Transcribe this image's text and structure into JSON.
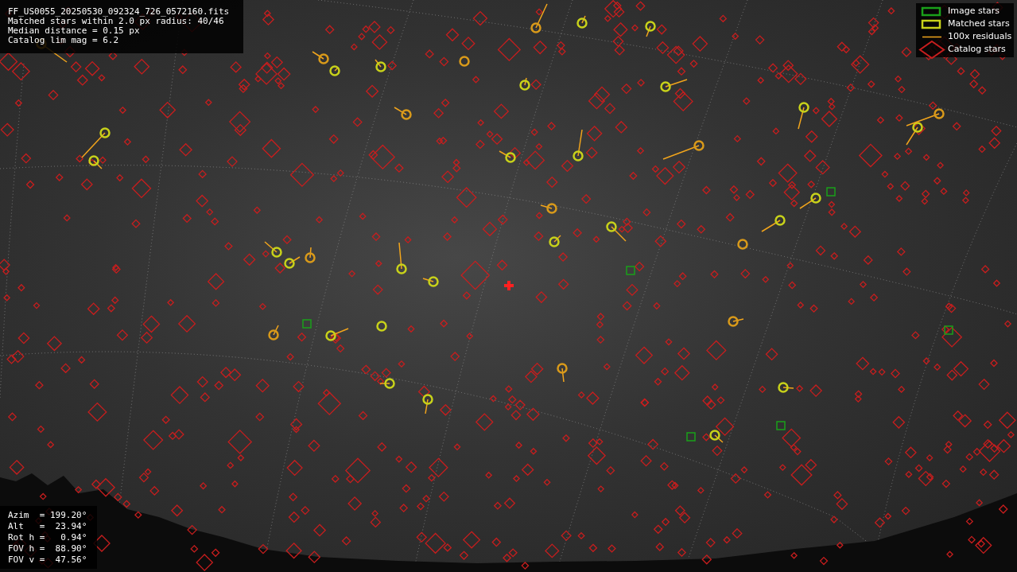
{
  "info_box": {
    "lines": [
      "FF_US0055_20250530_092324_726_0572160.fits",
      "Matched stars within 2.0 px radius: 40/46",
      "Median distance = 0.15 px",
      "Catalog lim mag = 6.2"
    ]
  },
  "legend": [
    {
      "kind": "image",
      "label": "Image stars"
    },
    {
      "kind": "matched",
      "label": "Matched stars"
    },
    {
      "kind": "residual",
      "label": "100x residuals"
    },
    {
      "kind": "catalog",
      "label": "Catalog stars"
    }
  ],
  "pointing": {
    "lines": [
      "Azim  = 199.20°",
      "Alt   =  23.94°",
      "Rot h =   0.94°",
      "FOV h =  88.90°",
      "FOV v =  47.56°"
    ]
  }
}
